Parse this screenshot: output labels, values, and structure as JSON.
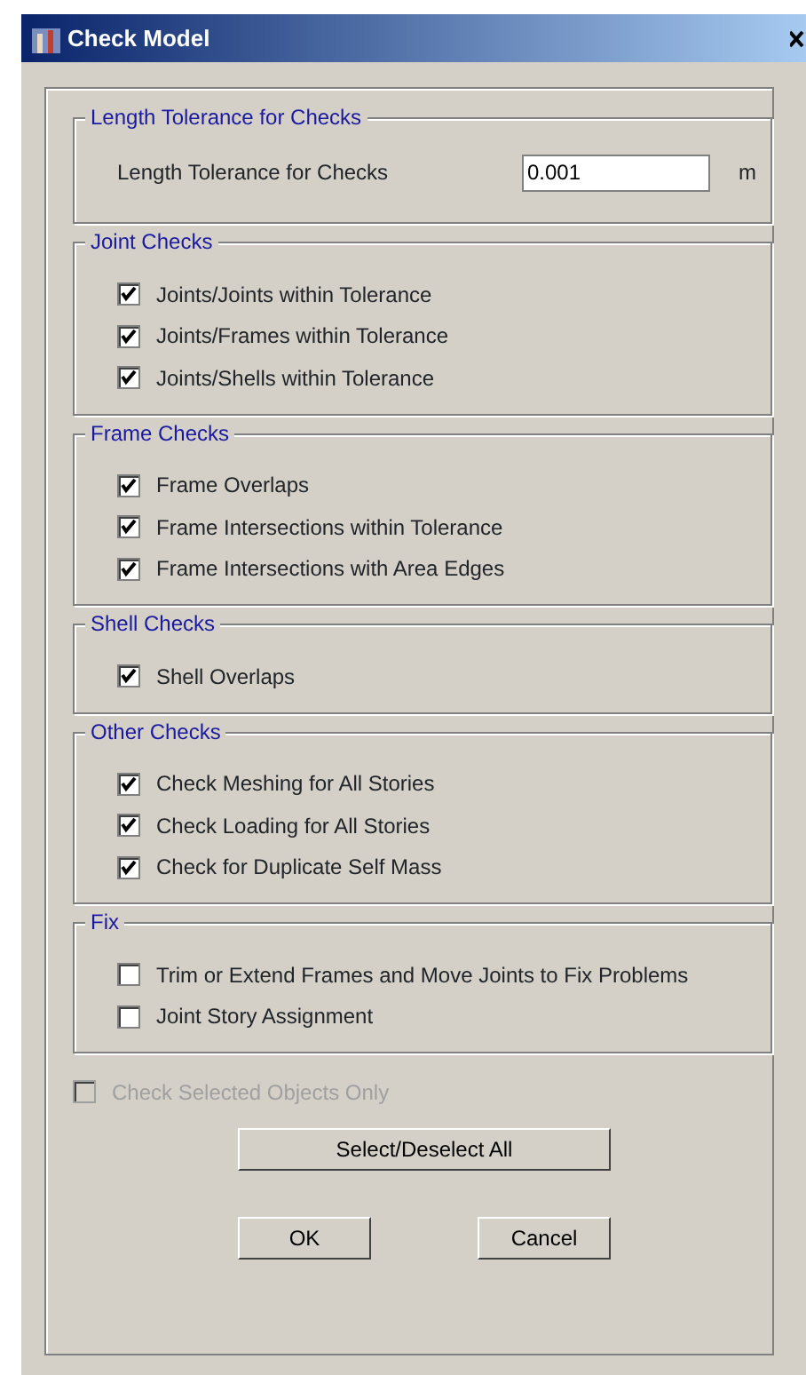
{
  "window": {
    "title": "Check Model"
  },
  "groups": [
    {
      "title": "Length Tolerance for Checks",
      "kind": "field",
      "label": "Length Tolerance for Checks",
      "value": "0.001",
      "unit": "m"
    },
    {
      "title": "Joint Checks",
      "kind": "checks",
      "items": [
        {
          "label": "Joints/Joints within Tolerance",
          "checked": true
        },
        {
          "label": "Joints/Frames within Tolerance",
          "checked": true
        },
        {
          "label": "Joints/Shells within Tolerance",
          "checked": true
        }
      ]
    },
    {
      "title": "Frame Checks",
      "kind": "checks",
      "items": [
        {
          "label": "Frame Overlaps",
          "checked": true
        },
        {
          "label": "Frame Intersections within Tolerance",
          "checked": true
        },
        {
          "label": "Frame Intersections with Area Edges",
          "checked": true
        }
      ]
    },
    {
      "title": "Shell Checks",
      "kind": "checks",
      "items": [
        {
          "label": "Shell Overlaps",
          "checked": true
        }
      ]
    },
    {
      "title": "Other Checks",
      "kind": "checks",
      "items": [
        {
          "label": "Check Meshing for All Stories",
          "checked": true
        },
        {
          "label": "Check Loading for All Stories",
          "checked": true
        },
        {
          "label": "Check for Duplicate Self Mass",
          "checked": true
        }
      ]
    },
    {
      "title": "Fix",
      "kind": "checks",
      "items": [
        {
          "label": "Trim or Extend Frames and Move Joints to Fix Problems",
          "checked": false
        },
        {
          "label": "Joint Story Assignment",
          "checked": false
        }
      ]
    }
  ],
  "selected_only": {
    "label": "Check Selected Objects Only",
    "checked": false,
    "disabled": true
  },
  "select_all_button": "Select/Deselect All",
  "buttons": [
    "OK",
    "Cancel"
  ]
}
